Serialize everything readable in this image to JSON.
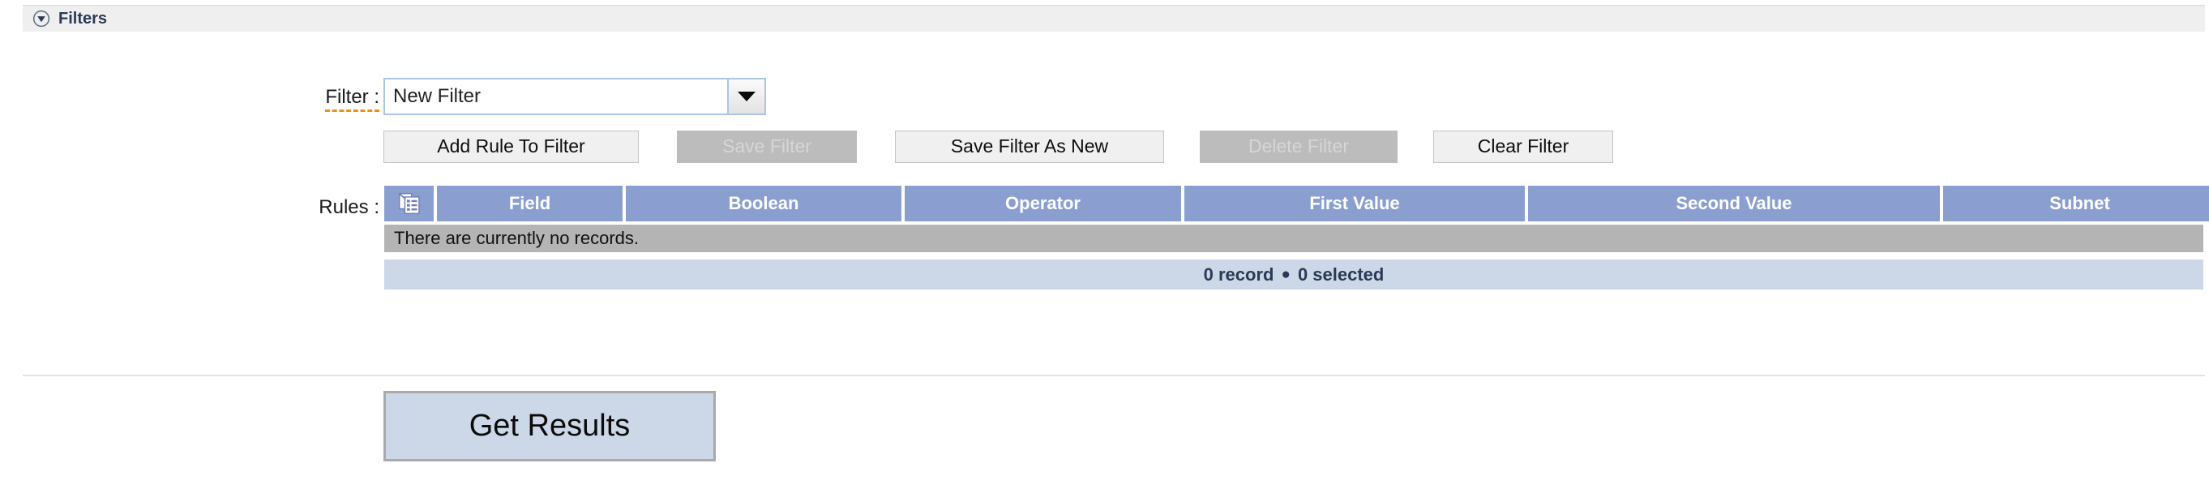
{
  "panel": {
    "title": "Filters",
    "collapse_icon": "circle-triangle-down-icon"
  },
  "filter_row": {
    "label": "Filter :",
    "value": "New Filter",
    "placeholder": "",
    "dropdown_icon": "chevron-down-icon"
  },
  "actions": {
    "add_rule": "Add Rule To Filter",
    "save_filter": "Save Filter",
    "save_filter_as_new": "Save Filter As New",
    "delete_filter": "Delete Filter",
    "clear_filter": "Clear Filter"
  },
  "rules": {
    "label": "Rules :",
    "select_icon": "records-list-icon",
    "columns": [
      "Field",
      "Boolean",
      "Operator",
      "First Value",
      "Second Value",
      "Subnet"
    ],
    "empty_message": "There are currently no records.",
    "footer": {
      "record_count": "0 record",
      "separator": "●",
      "selected_count": "0 selected"
    }
  },
  "footer_actions": {
    "get_results": "Get Results"
  },
  "colors": {
    "panel_header_bg": "#efefef",
    "panel_title": "#2b3a55",
    "grid_header_bg": "#8a9fd0",
    "grid_empty_bg": "#b4b4b4",
    "grid_footer_bg": "#ccd8e8",
    "combo_border": "#a9c6e8",
    "label_underline": "#e8941a",
    "button_bg": "#f0f0f0",
    "button_disabled_bg": "#bcbcbc"
  }
}
